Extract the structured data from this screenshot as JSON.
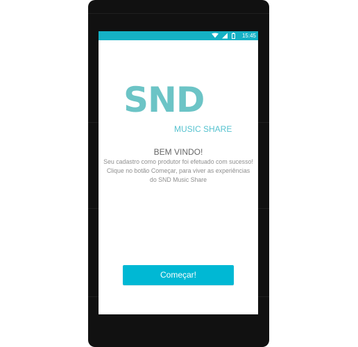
{
  "status_bar": {
    "time": "15:45",
    "color": "#15b1c5",
    "icons": [
      "wifi-icon",
      "signal-icon",
      "battery-icon"
    ]
  },
  "logo": {
    "title": "SND",
    "subtitle": "MUSIC SHARE",
    "color": "#6cc4c6"
  },
  "welcome": {
    "title": "BEM VINDO!",
    "message": "Seu cadastro como produtor foi efetuado com sucesso! Clique no botão Começar, para viver as experiências do SND Music Share"
  },
  "actions": {
    "start_label": "Começar!",
    "button_color": "#00b8d4"
  }
}
